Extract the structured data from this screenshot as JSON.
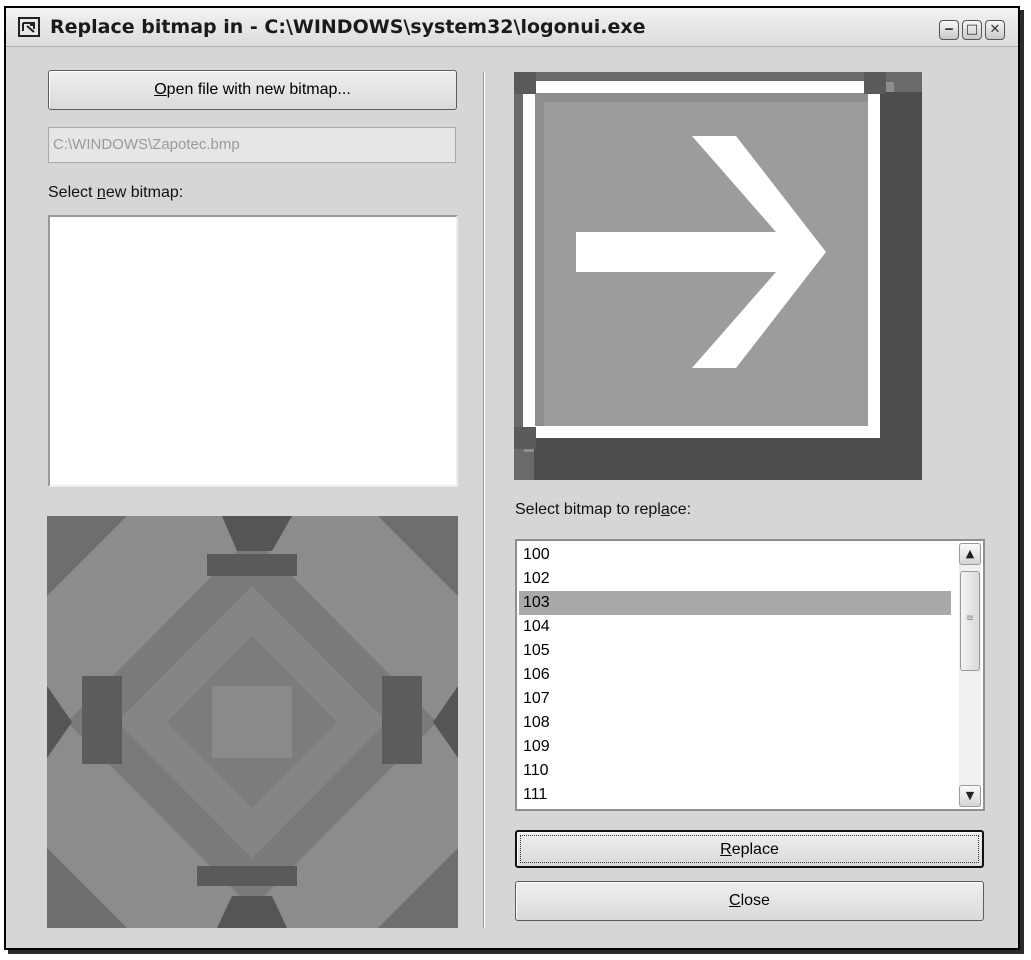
{
  "window": {
    "title": "Replace bitmap in - C:\\WINDOWS\\system32\\logonui.exe",
    "controls": {
      "minimize": "‒",
      "maximize": "□",
      "close": "✕"
    }
  },
  "left": {
    "open_button": {
      "pre": "",
      "mnemonic": "O",
      "post": "pen file with new bitmap..."
    },
    "file_path": "C:\\WINDOWS\\Zapotec.bmp",
    "select_new_label": {
      "pre": "Select ",
      "mnemonic": "n",
      "post": "ew bitmap:"
    }
  },
  "right": {
    "select_replace_label": {
      "pre": "Select bitmap to repl",
      "mnemonic": "a",
      "post": "ce:"
    },
    "bitmap_list": {
      "items": [
        "100",
        "102",
        "103",
        "104",
        "105",
        "106",
        "107",
        "108",
        "109",
        "110",
        "111"
      ],
      "selected": "103"
    },
    "replace_button": {
      "pre": "",
      "mnemonic": "R",
      "post": "eplace"
    },
    "close_button": {
      "pre": "",
      "mnemonic": "C",
      "post": "lose"
    }
  },
  "icons": {
    "app": "app-icon",
    "arrow_preview": "arrow-right-icon",
    "scroll_up": "chevron-up-icon",
    "scroll_down": "chevron-down-icon"
  }
}
